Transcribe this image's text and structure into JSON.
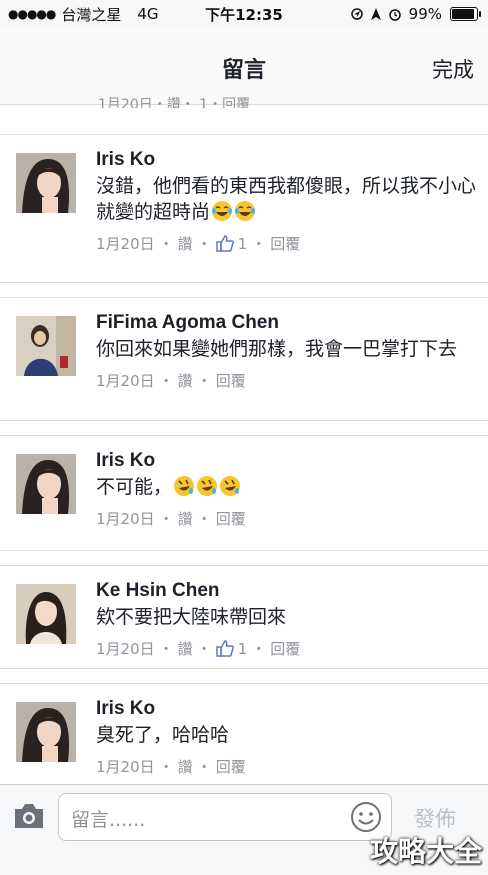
{
  "status_bar": {
    "carrier": "台灣之星",
    "network": "4G",
    "time": "下午12:35",
    "battery": "99%",
    "battery_level": 0.99
  },
  "nav": {
    "title": "留言",
    "done_label": "完成"
  },
  "partial_comment_meta": "1月20日・讚・ 1・回覆",
  "comments": [
    {
      "name": "Iris Ko",
      "text": "沒錯，他們看的東西我都傻眼，所以我不小心就變的超時尚",
      "emoji": [
        "tears-of-joy",
        "tears-of-joy"
      ],
      "date": "1月20日",
      "like_label": "讚",
      "like_count": "1",
      "reply_label": "回覆"
    },
    {
      "name": "FiFima Agoma Chen",
      "text": "你回來如果變她們那樣，我會一巴掌打下去",
      "date": "1月20日",
      "like_label": "讚",
      "reply_label": "回覆"
    },
    {
      "name": "Iris Ko",
      "text": "不可能，",
      "emoji": [
        "rofl",
        "rofl",
        "rofl"
      ],
      "date": "1月20日",
      "like_label": "讚",
      "reply_label": "回覆"
    },
    {
      "name": "Ke Hsin Chen",
      "text": "欸不要把大陸味帶回來",
      "date": "1月20日",
      "like_label": "讚",
      "like_count": "1",
      "reply_label": "回覆"
    },
    {
      "name": "Iris Ko",
      "text": "臭死了，哈哈哈",
      "date": "1月20日",
      "like_label": "讚",
      "reply_label": "回覆"
    }
  ],
  "composer": {
    "placeholder": "留言......",
    "send_label": "發佈"
  },
  "watermark": "攻略大全",
  "icons": {
    "camera": "camera-icon",
    "smiley": "smiley-icon",
    "like": "thumbs-up-icon",
    "location": "location-icon",
    "alarm": "alarm-icon"
  }
}
